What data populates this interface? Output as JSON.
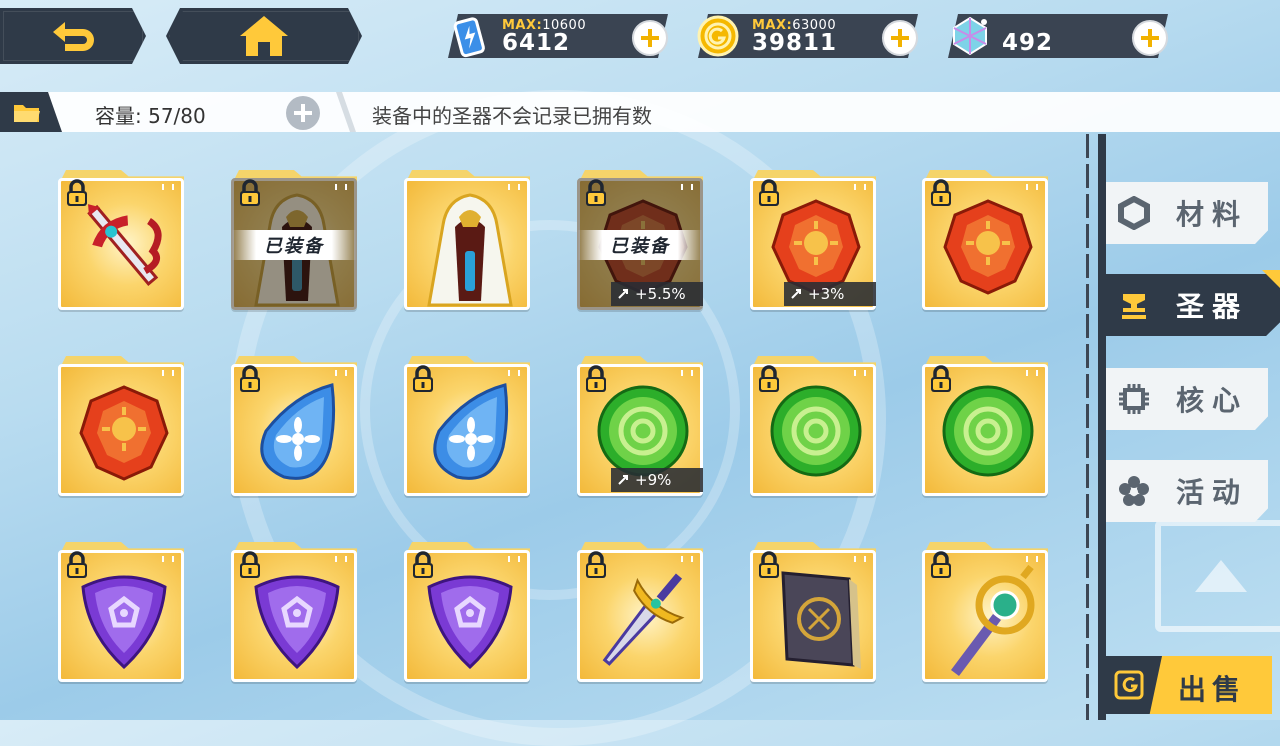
{
  "topbar": {
    "back_icon": "back-arrow-icon",
    "home_icon": "home-icon",
    "stamina": {
      "icon": "battery-icon",
      "max_label": "MAX:",
      "max_value": "10600",
      "value": "6412"
    },
    "gold": {
      "icon": "gold-coin-icon",
      "max_label": "MAX:",
      "max_value": "63000",
      "value": "39811"
    },
    "gems": {
      "icon": "crystal-icon",
      "value": "492"
    }
  },
  "infobar": {
    "capacity_label": "容量: 57/80",
    "notice": "装备中的圣器不会记录已拥有数"
  },
  "items": [
    {
      "type": "sword-red",
      "locked": true,
      "equipped": false,
      "stat": ""
    },
    {
      "type": "robe",
      "locked": true,
      "equipped": true,
      "stat": ""
    },
    {
      "type": "robe",
      "locked": false,
      "equipped": false,
      "stat": ""
    },
    {
      "type": "gem-red",
      "locked": true,
      "equipped": true,
      "stat": "+5.5%"
    },
    {
      "type": "gem-red",
      "locked": true,
      "equipped": false,
      "stat": "+3%"
    },
    {
      "type": "gem-red",
      "locked": true,
      "equipped": false,
      "stat": ""
    },
    {
      "type": "gem-red",
      "locked": false,
      "equipped": false,
      "stat": ""
    },
    {
      "type": "drop-blue",
      "locked": true,
      "equipped": false,
      "stat": ""
    },
    {
      "type": "drop-blue",
      "locked": true,
      "equipped": false,
      "stat": ""
    },
    {
      "type": "orb-green",
      "locked": true,
      "equipped": false,
      "stat": "+9%"
    },
    {
      "type": "orb-green",
      "locked": true,
      "equipped": false,
      "stat": ""
    },
    {
      "type": "orb-green",
      "locked": true,
      "equipped": false,
      "stat": ""
    },
    {
      "type": "gem-purple",
      "locked": true,
      "equipped": false,
      "stat": ""
    },
    {
      "type": "gem-purple",
      "locked": true,
      "equipped": false,
      "stat": ""
    },
    {
      "type": "gem-purple",
      "locked": true,
      "equipped": false,
      "stat": ""
    },
    {
      "type": "sword-gold",
      "locked": true,
      "equipped": false,
      "stat": ""
    },
    {
      "type": "book",
      "locked": true,
      "equipped": false,
      "stat": ""
    },
    {
      "type": "staff",
      "locked": true,
      "equipped": false,
      "stat": ""
    }
  ],
  "equipped_label": "已装备",
  "sidebar": {
    "tabs": [
      {
        "label": "材料",
        "icon": "hexagon-ring-icon"
      },
      {
        "label": "圣器",
        "icon": "relic-icon"
      },
      {
        "label": "核心",
        "icon": "chip-icon"
      },
      {
        "label": "活动",
        "icon": "flower-icon"
      }
    ],
    "active_tab": 1,
    "sell_label": "出售"
  },
  "colors": {
    "accent": "#ffc93a",
    "dark": "#2f3a48",
    "card": "#f5c850"
  }
}
